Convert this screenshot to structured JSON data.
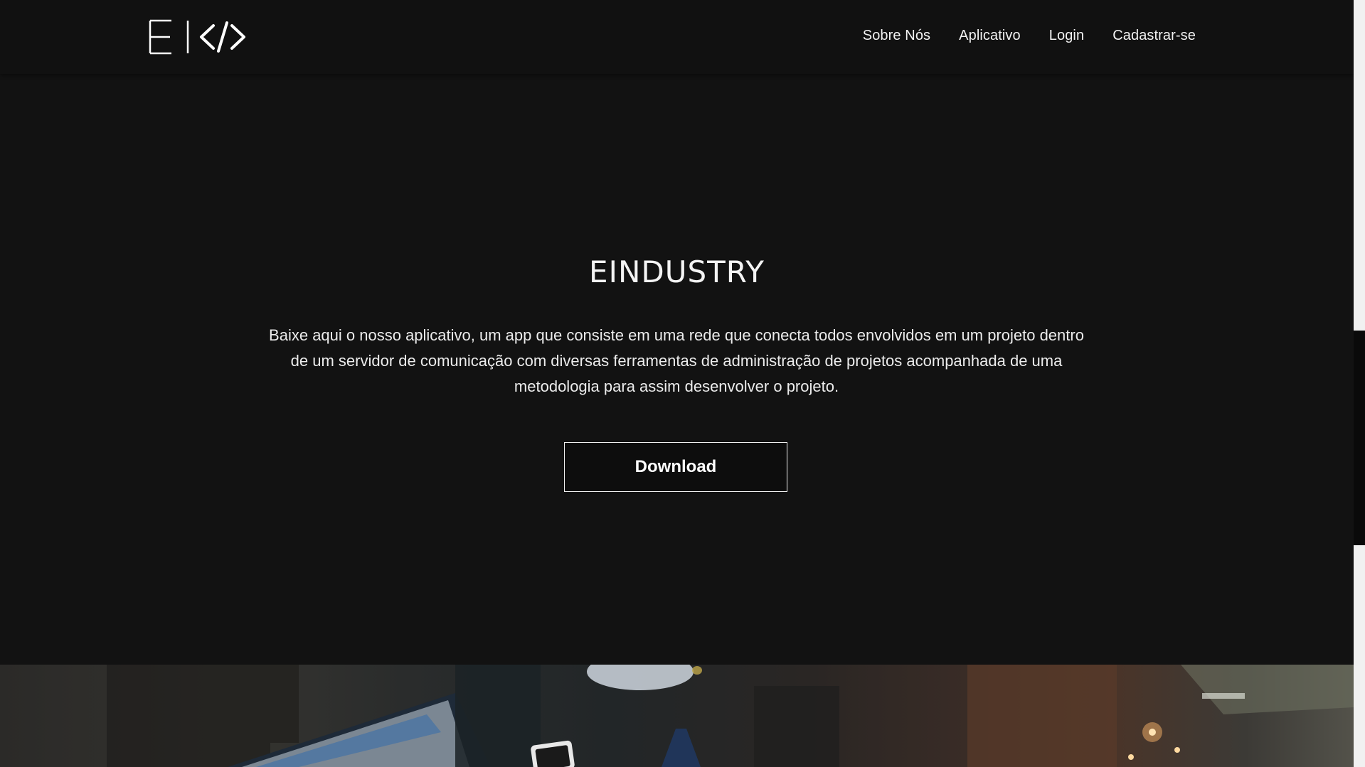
{
  "nav": {
    "logo_icon": "e-code-logo-icon",
    "items": [
      {
        "label": "Sobre Nós"
      },
      {
        "label": "Aplicativo"
      },
      {
        "label": "Login"
      },
      {
        "label": "Cadastrar-se"
      }
    ]
  },
  "hero": {
    "title": "EINDUSTRY",
    "description": "Baixe aqui o nosso aplicativo, um app que consiste em uma rede que conecta todos envolvidos em um projeto dentro de um servidor de comunicação com diversas ferramentas de administração de projetos acompanhada de uma metodologia para assim desenvolver o projeto.",
    "download_label": "Download"
  },
  "colors": {
    "background": "#121212",
    "navbar": "#111111",
    "text": "#ffffff",
    "button_border": "#f0f0f0"
  }
}
